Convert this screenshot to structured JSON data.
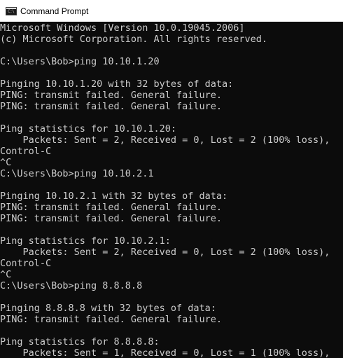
{
  "window": {
    "title": "Command Prompt",
    "icon": "console-icon",
    "icon_glyph": "C:\\"
  },
  "console": {
    "lines": [
      "Microsoft Windows [Version 10.0.19045.2006]",
      "(c) Microsoft Corporation. All rights reserved.",
      "",
      "C:\\Users\\Bob>ping 10.10.1.20",
      "",
      "Pinging 10.10.1.20 with 32 bytes of data:",
      "PING: transmit failed. General failure.",
      "PING: transmit failed. General failure.",
      "",
      "Ping statistics for 10.10.1.20:",
      "    Packets: Sent = 2, Received = 0, Lost = 2 (100% loss),",
      "Control-C",
      "^C",
      "C:\\Users\\Bob>ping 10.10.2.1",
      "",
      "Pinging 10.10.2.1 with 32 bytes of data:",
      "PING: transmit failed. General failure.",
      "PING: transmit failed. General failure.",
      "",
      "Ping statistics for 10.10.2.1:",
      "    Packets: Sent = 2, Received = 0, Lost = 2 (100% loss),",
      "Control-C",
      "^C",
      "C:\\Users\\Bob>ping 8.8.8.8",
      "",
      "Pinging 8.8.8.8 with 32 bytes of data:",
      "PING: transmit failed. General failure.",
      "",
      "Ping statistics for 8.8.8.8:",
      "    Packets: Sent = 1, Received = 0, Lost = 1 (100% loss),"
    ]
  },
  "colors": {
    "console_background": "#0c0c0c",
    "console_text": "#cccccc",
    "titlebar_background": "#ffffff"
  }
}
